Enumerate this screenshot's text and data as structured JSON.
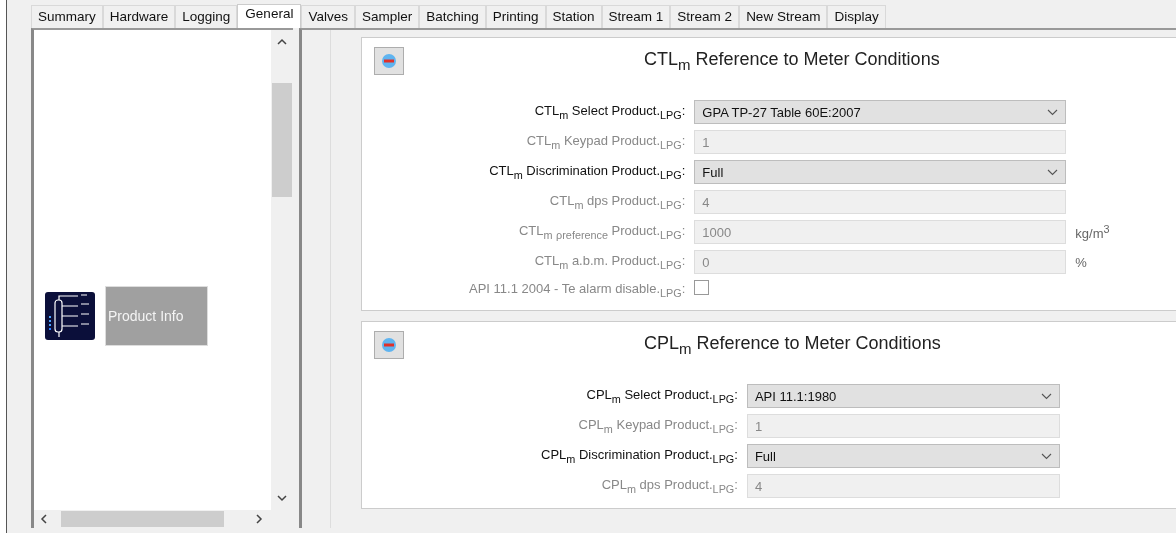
{
  "tabs": [
    {
      "label": "Summary",
      "selected": false
    },
    {
      "label": "Hardware",
      "selected": false
    },
    {
      "label": "Logging",
      "selected": false
    },
    {
      "label": "General",
      "selected": true
    },
    {
      "label": "Valves",
      "selected": false
    },
    {
      "label": "Sampler",
      "selected": false
    },
    {
      "label": "Batching",
      "selected": false
    },
    {
      "label": "Printing",
      "selected": false
    },
    {
      "label": "Station",
      "selected": false
    },
    {
      "label": "Stream 1",
      "selected": false
    },
    {
      "label": "Stream 2",
      "selected": false
    },
    {
      "label": "New Stream",
      "selected": false
    },
    {
      "label": "Display",
      "selected": false
    }
  ],
  "sidebar": {
    "items": [
      {
        "label": "Product Info"
      }
    ]
  },
  "sections": [
    {
      "title": "CTL$_{m}$ Reference to Meter Conditions",
      "rows": [
        {
          "kind": "select",
          "label": "CTL$_{m}$ Select Product.$_{LPG}$:",
          "value": "GPA TP-27 Table 60E:2007",
          "disabled": false
        },
        {
          "kind": "text",
          "label": "CTL$_{m}$ Keypad Product.$_{LPG}$:",
          "value": "1",
          "disabled": true
        },
        {
          "kind": "select",
          "label": "CTL$_{m}$ Discrimination Product.$_{LPG}$:",
          "value": "Full",
          "disabled": false
        },
        {
          "kind": "text",
          "label": "CTL$_{m}$ dps Product.$_{LPG}$:",
          "value": "4",
          "disabled": true
        },
        {
          "kind": "text",
          "label": "CTL$_{m}$ $_{ρreference}$ Product.$_{LPG}$:",
          "value": "1000",
          "unit": "kg/m$^{3}$",
          "disabled": true
        },
        {
          "kind": "text",
          "label": "CTL$_{m}$ a.b.m. Product.$_{LPG}$:",
          "value": "0",
          "unit": "%",
          "disabled": true
        },
        {
          "kind": "checkbox",
          "label": "API 11.1 2004 - Te alarm disable.$_{LPG}$:",
          "checked": false,
          "disabled": true
        }
      ]
    },
    {
      "title": "CPL$_{m}$ Reference to Meter Conditions",
      "rows": [
        {
          "kind": "select",
          "label": "CPL$_{m}$ Select Product.$_{LPG}$:",
          "value": "API 11.1:1980",
          "disabled": false
        },
        {
          "kind": "text",
          "label": "CPL$_{m}$ Keypad Product.$_{LPG}$:",
          "value": "1",
          "disabled": true
        },
        {
          "kind": "select",
          "label": "CPL$_{m}$ Discrimination Product.$_{LPG}$:",
          "value": "Full",
          "disabled": false
        },
        {
          "kind": "text",
          "label": "CPL$_{m}$ dps Product.$_{LPG}$:",
          "value": "4",
          "disabled": true
        }
      ]
    }
  ]
}
